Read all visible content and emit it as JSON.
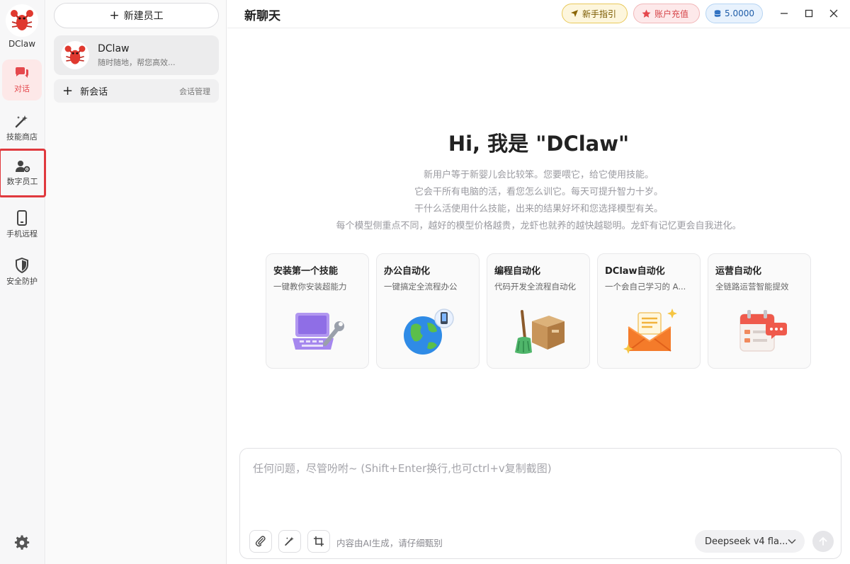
{
  "rail": {
    "brand": "DClaw",
    "items": [
      {
        "label": "对话"
      },
      {
        "label": "技能商店"
      },
      {
        "label": "数字员工"
      },
      {
        "label": "手机远程"
      },
      {
        "label": "安全防护"
      }
    ]
  },
  "panel": {
    "new_employee_label": "新建员工",
    "agent": {
      "name": "DClaw",
      "desc": "随时随地，帮您高效..."
    },
    "new_chat_label": "新会话",
    "manage_label": "会话管理"
  },
  "header": {
    "title": "新聊天",
    "guide_label": "新手指引",
    "recharge_label": "账户充值",
    "balance": "5.0000"
  },
  "hero": {
    "title": "Hi, 我是 \"DClaw\"",
    "lines": [
      "新用户等于新婴儿会比较笨。您要喂它，给它使用技能。",
      "它会干所有电脑的活，看您怎么训它。每天可提升智力十岁。",
      "干什么活使用什么技能，出来的结果好坏和您选择模型有关。",
      "每个模型侧重点不同，越好的模型价格越贵，龙虾也就养的越快越聪明。龙虾有记忆更会自我进化。"
    ]
  },
  "cards": [
    {
      "title": "安装第一个技能",
      "desc": "一键教你安装超能力",
      "icon": "laptop-wrench"
    },
    {
      "title": "办公自动化",
      "desc": "一键搞定全流程办公",
      "icon": "globe-phone"
    },
    {
      "title": "编程自动化",
      "desc": "代码开发全流程自动化",
      "icon": "box-broom"
    },
    {
      "title": "DClaw自动化",
      "desc": "一个会自己学习的 A...",
      "icon": "mail-sparkle"
    },
    {
      "title": "运营自动化",
      "desc": "全链路运营智能提效",
      "icon": "calendar-chat"
    }
  ],
  "composer": {
    "placeholder": "任何问题，尽管吩咐~ (Shift+Enter换行,也可ctrl+v复制截图)",
    "note": "内容由AI生成，请仔细甄别",
    "model": "Deepseek v4 fla..."
  },
  "colors": {
    "accent_red": "#e5484d",
    "highlight_box": "#e0393e"
  }
}
